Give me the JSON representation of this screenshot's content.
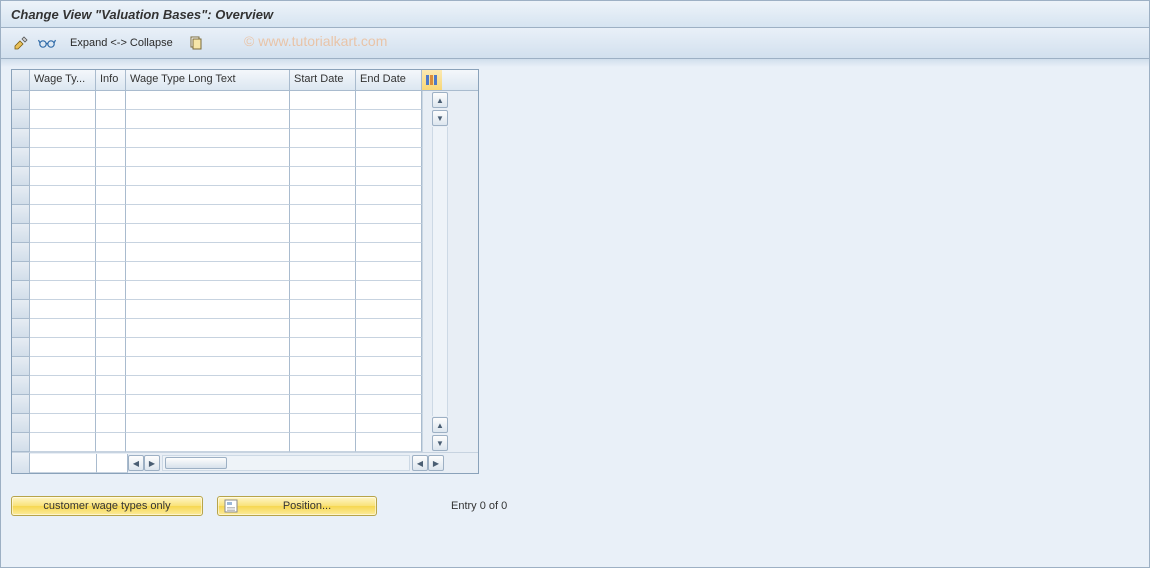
{
  "title": "Change View \"Valuation Bases\": Overview",
  "toolbar": {
    "expand_collapse": "Expand <-> Collapse"
  },
  "watermark": "© www.tutorialkart.com",
  "table": {
    "columns": {
      "wage_type": "Wage Ty...",
      "info": "Info",
      "long_text": "Wage Type Long Text",
      "start_date": "Start Date",
      "end_date": "End Date"
    },
    "rows": [
      {},
      {},
      {},
      {},
      {},
      {},
      {},
      {},
      {},
      {},
      {},
      {},
      {},
      {},
      {},
      {},
      {},
      {},
      {}
    ]
  },
  "buttons": {
    "customer_only": "customer wage types only",
    "position": "Position..."
  },
  "status": {
    "entry": "Entry 0 of 0"
  }
}
